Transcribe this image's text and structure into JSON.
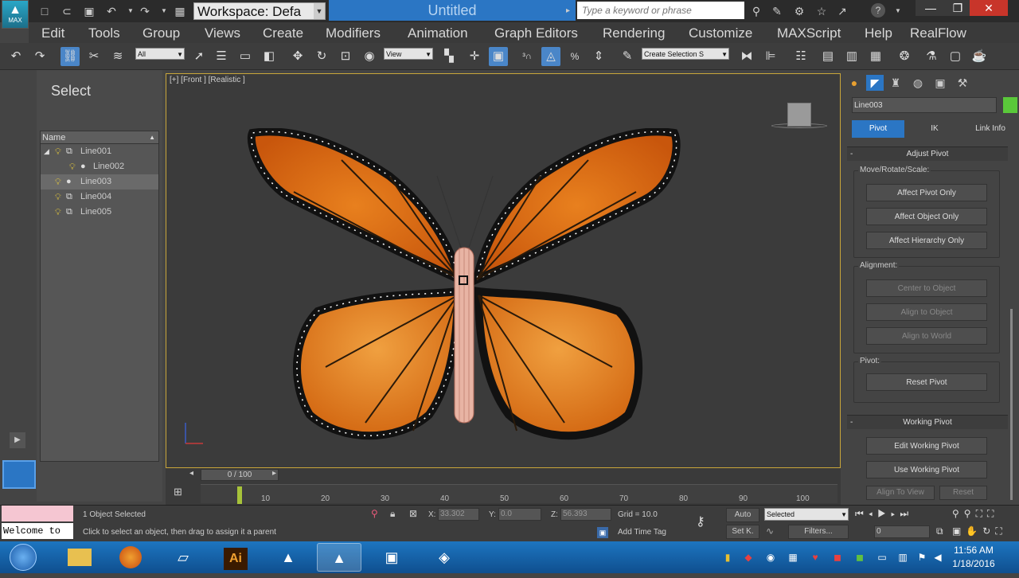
{
  "titlebar": {
    "app_logo": "MAX",
    "workspace": "Workspace: Defa",
    "window_title": "Untitled",
    "search_placeholder": "Type a keyword or phrase"
  },
  "menubar": [
    "Edit",
    "Tools",
    "Group",
    "Views",
    "Create",
    "Modifiers",
    "Animation",
    "Graph Editors",
    "Rendering",
    "Customize",
    "MAXScript",
    "Help",
    "RealFlow"
  ],
  "toolbar": {
    "filter_value": "All",
    "ref_coord_value": "View",
    "selection_set_value": "Create Selection S"
  },
  "scene_explorer": {
    "title": "Select",
    "column_name": "Name",
    "items": [
      {
        "label": "Line001",
        "level": 0,
        "selected": false
      },
      {
        "label": "Line002",
        "level": 1,
        "selected": false
      },
      {
        "label": "Line003",
        "level": 0,
        "selected": true
      },
      {
        "label": "Line004",
        "level": 0,
        "selected": false
      },
      {
        "label": "Line005",
        "level": 0,
        "selected": false
      }
    ]
  },
  "viewport": {
    "label": "[+] [Front ] [Realistic ]"
  },
  "command_panel": {
    "object_name": "Line003",
    "object_color": "#5ac83a",
    "tabs": [
      "Pivot",
      "IK",
      "Link Info"
    ],
    "adjust_pivot": {
      "title": "Adjust Pivot",
      "group_move": "Move/Rotate/Scale:",
      "affect_pivot_only": "Affect Pivot Only",
      "affect_object_only": "Affect Object Only",
      "affect_hierarchy_only": "Affect Hierarchy Only",
      "group_alignment": "Alignment:",
      "center_to_object": "Center to Object",
      "align_to_object": "Align to Object",
      "align_to_world": "Align to World",
      "group_pivot": "Pivot:",
      "reset_pivot": "Reset Pivot"
    },
    "working_pivot": {
      "title": "Working Pivot",
      "edit_working_pivot": "Edit Working Pivot",
      "use_working_pivot": "Use Working Pivot",
      "align_to_view": "Align To View",
      "reset": "Reset"
    }
  },
  "timeline": {
    "slider": "0 / 100",
    "ticks": [
      "10",
      "20",
      "30",
      "40",
      "50",
      "60",
      "70",
      "80",
      "90",
      "100"
    ]
  },
  "statusbar": {
    "listener_text": "Welcome to",
    "objects_selected": "1 Object Selected",
    "prompt": "Click to select an object, then drag to assign it a parent",
    "x_label": "X:",
    "x_value": "33.302",
    "y_label": "Y:",
    "y_value": "0.0",
    "z_label": "Z:",
    "z_value": "56.393",
    "grid": "Grid = 10.0",
    "add_time_tag": "Add Time Tag",
    "auto": "Auto",
    "setk": "Set K.",
    "key_mode": "Selected",
    "filters": "Filters...",
    "frame": "0"
  },
  "taskbar": {
    "time": "11:56 AM",
    "date": "1/18/2016",
    "illustrator_label": "Ai"
  }
}
